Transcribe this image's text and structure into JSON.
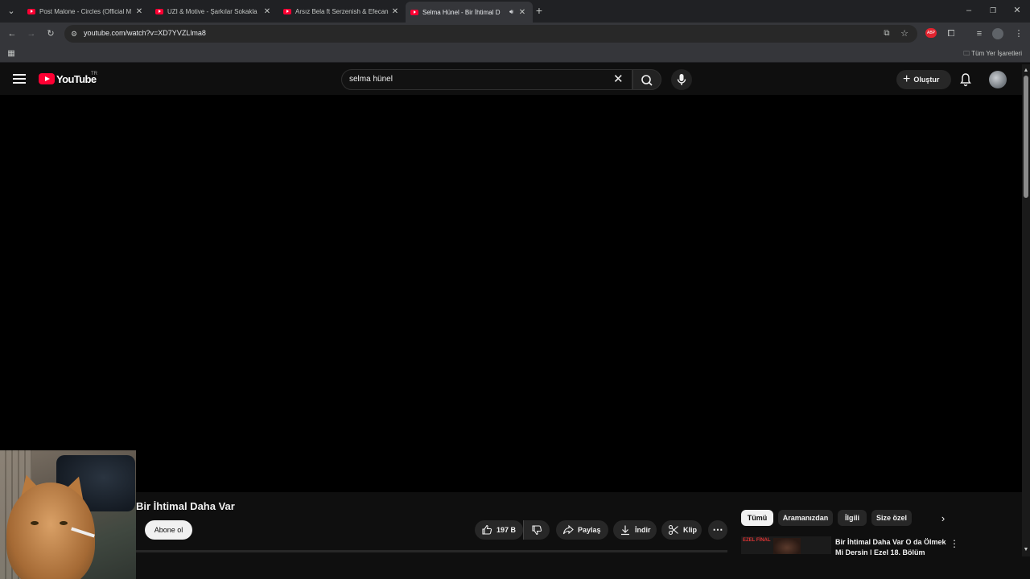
{
  "browser": {
    "tabs": [
      {
        "title": "Post Malone - Circles (Official M",
        "active": false
      },
      {
        "title": "UZI & Motive - Şarkılar Sokakla",
        "active": false
      },
      {
        "title": "Arsız Bela ft Serzenish & Efecan",
        "active": false
      },
      {
        "title": "Selma Hünel - Bir İhtimal D",
        "active": true
      }
    ],
    "url": "youtube.com/watch?v=XD7YVZLlma8",
    "bookmarks_label": "Tüm Yer İşaretleri"
  },
  "masthead": {
    "logo_text": "YouTube",
    "country_code": "TR",
    "search_value": "selma hünel",
    "create_label": "Oluştur"
  },
  "video": {
    "title": "Bir İhtimal Daha Var",
    "subscribe_label": "Abone ol",
    "like_count": "197 B",
    "share_label": "Paylaş",
    "download_label": "İndir",
    "clip_label": "Klip"
  },
  "filter_chips": [
    "Tümü",
    "Aramanızdan",
    "İlgili",
    "Size özel"
  ],
  "recommendation": {
    "title": "Bir İhtimal Daha Var O da Ölmek Mi Dersin | Ezel 18. Bölüm",
    "thumb_tag": "EZEL FİNAL"
  },
  "colors": {
    "background": "#0f0f0f",
    "youtube_red": "#ff0033",
    "chip_active": "#f1f1f1",
    "chip": "#272727"
  }
}
